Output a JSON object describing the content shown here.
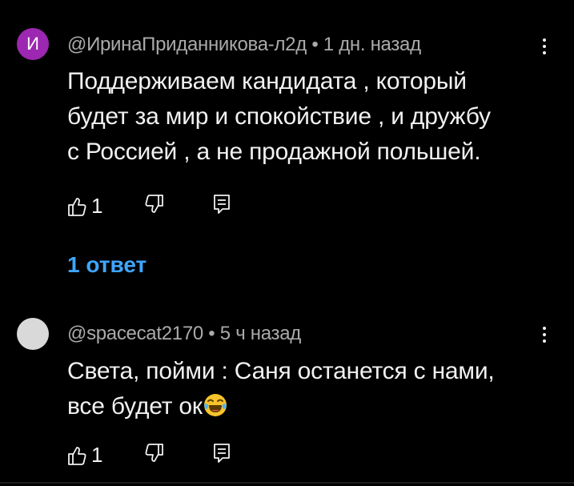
{
  "comments": [
    {
      "avatar_letter": "И",
      "avatar_color": "#9c27b0",
      "author": "@ИринаПриданникова-л2д",
      "separator": "•",
      "time": "1 дн. назад",
      "lines": [
        "Поддерживаем кандидата , который",
        "будет за мир и спокойствие , и дружбу",
        "с Россией , а не продажной польшей."
      ],
      "likes": "1"
    },
    {
      "avatar_letter": "",
      "avatar_color": "#d9d9d9",
      "author": "@spacecat2170",
      "separator": "•",
      "time": "5 ч назад",
      "lines": [
        "Света, пойми : Саня останется с нами,",
        "все будет ок"
      ],
      "emoji": "laughing-with-tears-emoji",
      "likes": "1"
    }
  ],
  "replies_label": "1 ответ",
  "colors": {
    "link": "#3ea6ff",
    "meta": "#aaaaaa",
    "text": "#f1f1f1",
    "background": "#000000"
  },
  "icons": [
    "like-icon",
    "dislike-icon",
    "reply-icon",
    "more-vert-icon"
  ]
}
